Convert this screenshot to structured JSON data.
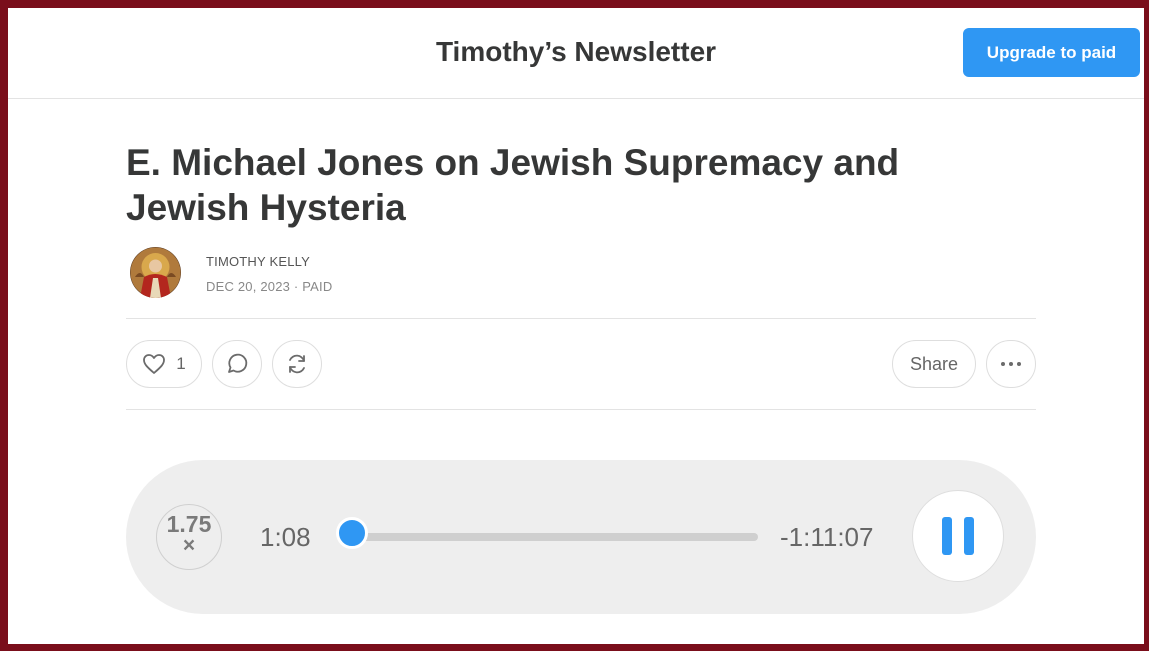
{
  "header": {
    "publication_title": "Timothy’s Newsletter",
    "upgrade_label": "Upgrade to paid"
  },
  "post": {
    "title": "E. Michael Jones on Jewish Supremacy and Jewish Hysteria",
    "author": "TIMOTHY KELLY",
    "date": "DEC 20, 2023",
    "separator": "·",
    "access": "PAID"
  },
  "actions": {
    "like_count": "1",
    "share_label": "Share",
    "icons": [
      "heart-icon",
      "comment-icon",
      "restack-icon",
      "more-icon"
    ]
  },
  "player": {
    "speed": "1.75",
    "speed_suffix": "×",
    "current_time": "1:08",
    "remaining_time": "-1:11:07",
    "progress_fraction": 0.015,
    "state": "playing",
    "accent_color": "#2f97f3"
  },
  "colors": {
    "border": "#7a0e1b",
    "accent": "#2f97f3",
    "text": "#363737"
  }
}
